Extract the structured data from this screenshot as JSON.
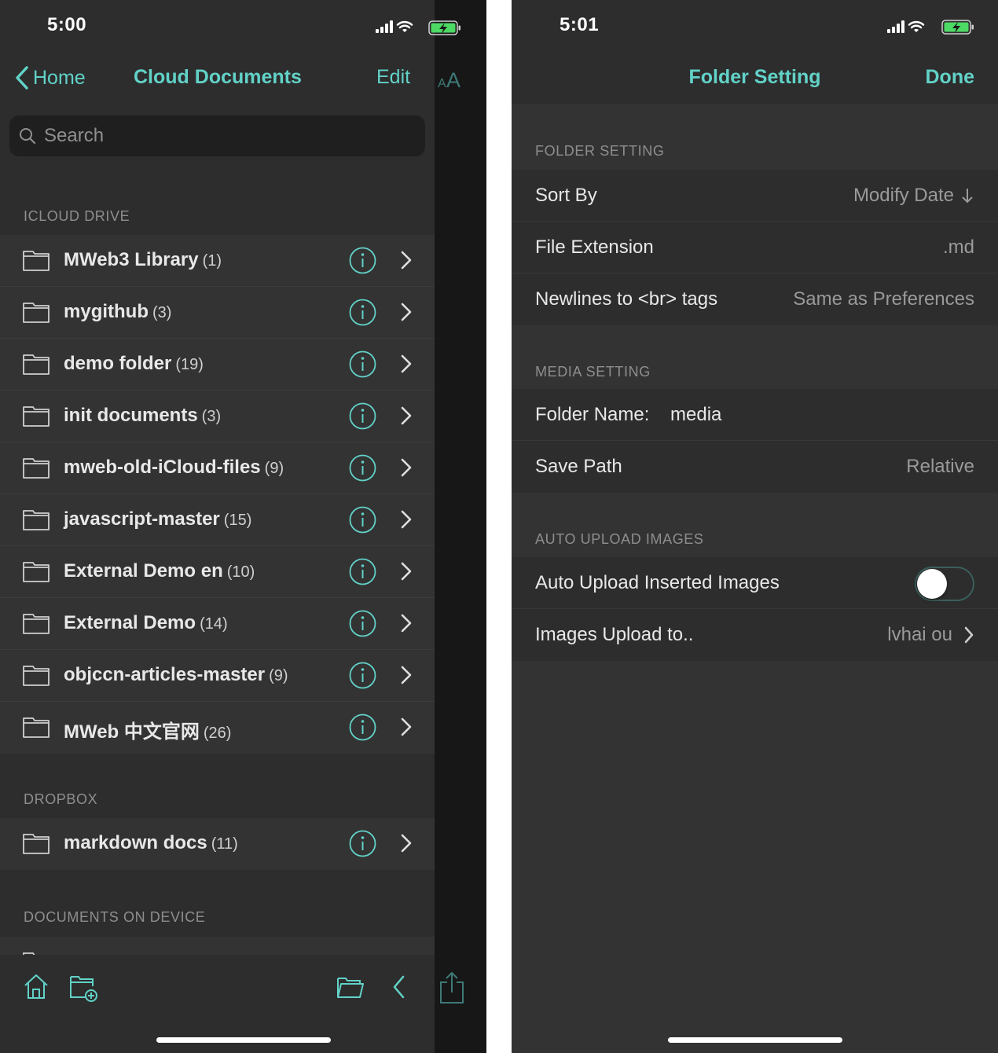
{
  "left_screen": {
    "status": {
      "time": "5:00"
    },
    "nav": {
      "back_label": "Home",
      "title": "Cloud Documents",
      "edit_label": "Edit"
    },
    "search": {
      "placeholder": "Search"
    },
    "sections": {
      "icloud": "ICLOUD DRIVE",
      "dropbox": "DROPBOX",
      "device": "DOCUMENTS ON DEVICE"
    },
    "icloud_folders": [
      {
        "name": "MWeb3 Library",
        "count": "(1)"
      },
      {
        "name": "mygithub",
        "count": "(3)"
      },
      {
        "name": "demo folder",
        "count": "(19)"
      },
      {
        "name": "init documents",
        "count": "(3)"
      },
      {
        "name": "mweb-old-iCloud-files",
        "count": "(9)"
      },
      {
        "name": "javascript-master",
        "count": "(15)"
      },
      {
        "name": "External Demo en",
        "count": "(10)"
      },
      {
        "name": "External Demo",
        "count": "(14)"
      },
      {
        "name": "objccn-articles-master",
        "count": "(9)"
      },
      {
        "name": "MWeb 中文官网",
        "count": "(26)"
      }
    ],
    "dropbox_folders": [
      {
        "name": "markdown docs",
        "count": "(11)"
      }
    ],
    "toolbar_icons": [
      "home-icon",
      "new-folder-icon",
      "folder-icon",
      "back-chevron-icon",
      "share-icon"
    ],
    "font_size_icon": "text-size-icon"
  },
  "right_screen": {
    "status": {
      "time": "5:01"
    },
    "nav": {
      "title": "Folder Setting",
      "done_label": "Done"
    },
    "sections": {
      "folder": "FOLDER SETTING",
      "media": "MEDIA SETTING",
      "upload": "AUTO UPLOAD IMAGES"
    },
    "folder_settings": {
      "sort_by_label": "Sort By",
      "sort_by_value": "Modify Date",
      "file_extension_label": "File Extension",
      "file_extension_value": ".md",
      "newlines_label": "Newlines to <br> tags",
      "newlines_value": "Same as Preferences"
    },
    "media_settings": {
      "folder_name_label": "Folder Name:",
      "folder_name_value": "media",
      "save_path_label": "Save Path",
      "save_path_value": "Relative"
    },
    "upload_settings": {
      "auto_upload_label": "Auto Upload Inserted Images",
      "auto_upload_enabled": false,
      "upload_to_label": "Images Upload to..",
      "upload_to_value": "lvhai ou"
    }
  },
  "colors": {
    "accent": "#62d2c8",
    "background": "#333333",
    "bar": "#2d2d2d"
  }
}
